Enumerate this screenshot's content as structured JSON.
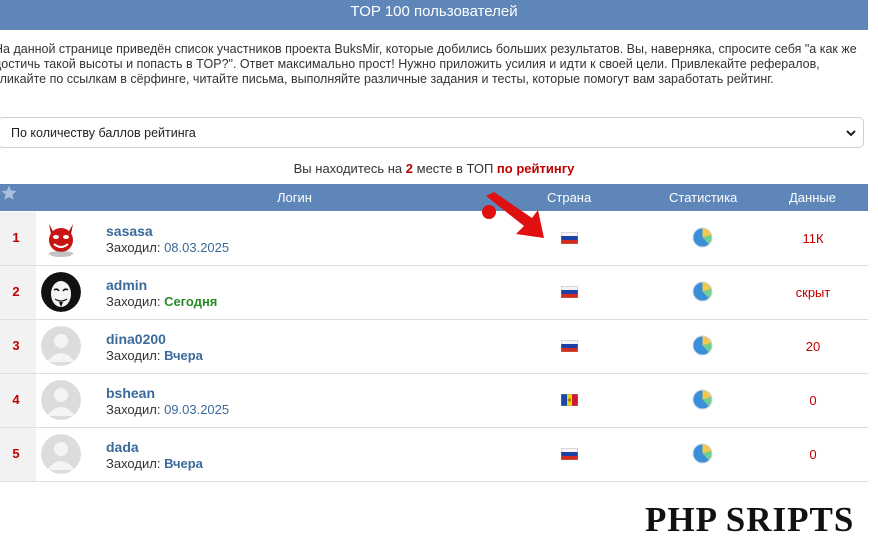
{
  "header": {
    "title": "TOP 100 пользователей"
  },
  "intro": {
    "text": "На данной странице приведён список участников проекта BuksMir, которые добились больших результатов. Вы, наверняка, спросите себя \"а как же достичь такой высоты и попасть в TOP?\". Ответ максимально прост! Нужно приложить усилия и идти к своей цели. Привлекайте рефералов, кликайте по ссылкам в сёрфинге, читайте письма, выполняйте различные задания и тесты, которые помогут вам заработать рейтинг."
  },
  "sort_select": {
    "value": "По количеству баллов рейтинга"
  },
  "rank_line": {
    "prefix": "Вы находитесь на",
    "position": "2",
    "middle": "месте в ТОП",
    "link": "по рейтингу"
  },
  "table": {
    "columns": {
      "login": "Логин",
      "country": "Страна",
      "stats": "Статистика",
      "data": "Данные"
    },
    "visited_label": "Заходил:",
    "rows": [
      {
        "rank": "1",
        "login": "sasasa",
        "visited": "08.03.2025",
        "visited_type": "date",
        "avatar": "devil-avatar",
        "flag": "russia-flag",
        "data": "11К"
      },
      {
        "rank": "2",
        "login": "admin",
        "visited": "Сегодня",
        "visited_type": "today",
        "avatar": "mask-avatar",
        "flag": "russia-flag",
        "data": "скрыт"
      },
      {
        "rank": "3",
        "login": "dina0200",
        "visited": "Вчера",
        "visited_type": "yest",
        "avatar": "default-avatar",
        "flag": "russia-flag",
        "data": "20"
      },
      {
        "rank": "4",
        "login": "bshean",
        "visited": "09.03.2025",
        "visited_type": "date",
        "avatar": "default-avatar",
        "flag": "moldova-flag",
        "data": "0"
      },
      {
        "rank": "5",
        "login": "dada",
        "visited": "Вчера",
        "visited_type": "yest",
        "avatar": "default-avatar",
        "flag": "russia-flag",
        "data": "0"
      }
    ]
  },
  "watermark": {
    "text": "PHP SRIPTS"
  },
  "colors": {
    "header_bg": "#5f86b9",
    "accent_red": "#c00000",
    "link_blue": "#3b6a9b",
    "today_green": "#2a8a2a"
  }
}
